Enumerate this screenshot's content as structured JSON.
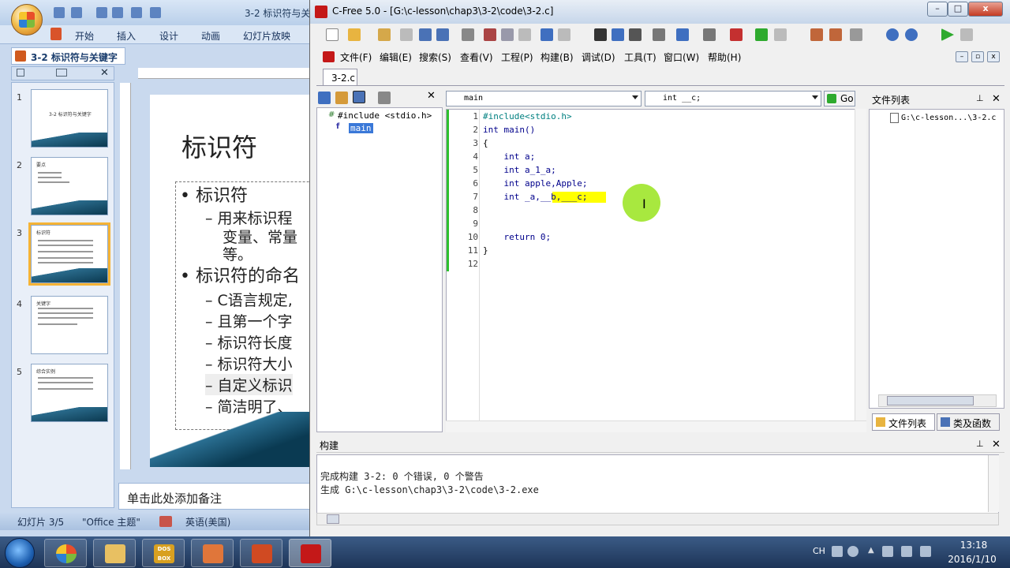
{
  "powerpoint": {
    "title": "3-2 标识符与关",
    "ribbon_tabs": [
      "开始",
      "插入",
      "设计",
      "动画",
      "幻灯片放映"
    ],
    "doc_tab": "3-2 标识符与关键字",
    "thumbnails": [
      {
        "num": "1",
        "title": "3-2 标识符与关键字"
      },
      {
        "num": "2",
        "title": "要点"
      },
      {
        "num": "3",
        "title": "标识符"
      },
      {
        "num": "4",
        "title": "关键字"
      },
      {
        "num": "5",
        "title": "综合实例"
      }
    ],
    "selected_slide": 3,
    "slide": {
      "title": "标识符",
      "bullets": [
        "• 标识符",
        "– 用来标识程",
        "变量、常量",
        "等。",
        "• 标识符的命名",
        "– C语言规定,",
        "– 且第一个字",
        "– 标识符长度",
        "– 标识符大小",
        "– 自定义标识",
        "– 简洁明了、"
      ]
    },
    "notes_placeholder": "单击此处添加备注",
    "status": {
      "slide": "幻灯片 3/5",
      "theme": "\"Office 主题\"",
      "language": "英语(美国)"
    }
  },
  "cfree": {
    "title": "C-Free 5.0 - [G:\\c-lesson\\chap3\\3-2\\code\\3-2.c]",
    "window_buttons": {
      "min": "–",
      "max": "□",
      "close": "x"
    },
    "menu": [
      "文件(F)",
      "编辑(E)",
      "搜索(S)",
      "查看(V)",
      "工程(P)",
      "构建(B)",
      "调试(D)",
      "工具(T)",
      "窗口(W)",
      "帮助(H)"
    ],
    "file_tab": "3-2.c",
    "tree": {
      "include": "#include <stdio.h>",
      "main": "main"
    },
    "combo_func": "main",
    "combo_symbol": "int __c;",
    "go_label": "Go",
    "code_lines": [
      {
        "n": "1",
        "text": "#include<stdio.h>"
      },
      {
        "n": "2",
        "text": "int main()"
      },
      {
        "n": "3",
        "text": "{"
      },
      {
        "n": "4",
        "text": "    int a;"
      },
      {
        "n": "5",
        "text": "    int a_1_a;"
      },
      {
        "n": "6",
        "text": "    int apple,Apple;"
      },
      {
        "n": "7",
        "text": "    int _a,__b,___c;"
      },
      {
        "n": "8",
        "text": ""
      },
      {
        "n": "9",
        "text": ""
      },
      {
        "n": "10",
        "text": "    return 0;"
      },
      {
        "n": "11",
        "text": "}"
      },
      {
        "n": "12",
        "text": ""
      }
    ],
    "right_panel": {
      "title": "文件列表",
      "file": "G:\\c-lesson...\\3-2.c",
      "tab_files": "文件列表",
      "tab_classes": "类及函数"
    },
    "build": {
      "title": "构建",
      "line1": "完成构建 3-2: 0 个错误, 0 个警告",
      "line2": "生成 G:\\c-lesson\\chap3\\3-2\\code\\3-2.exe"
    }
  },
  "taskbar": {
    "ime": "CH",
    "time": "13:18",
    "date": "2016/1/10",
    "apps": [
      "explorer",
      "dosbox",
      "player",
      "powerpoint",
      "cfree"
    ],
    "dosbox_label": "DOS BOX"
  },
  "colors": {
    "accent": "#3a78d8",
    "highlight": "#ffff00",
    "cursor": "#9ee62a",
    "keyword": "#00008b"
  }
}
